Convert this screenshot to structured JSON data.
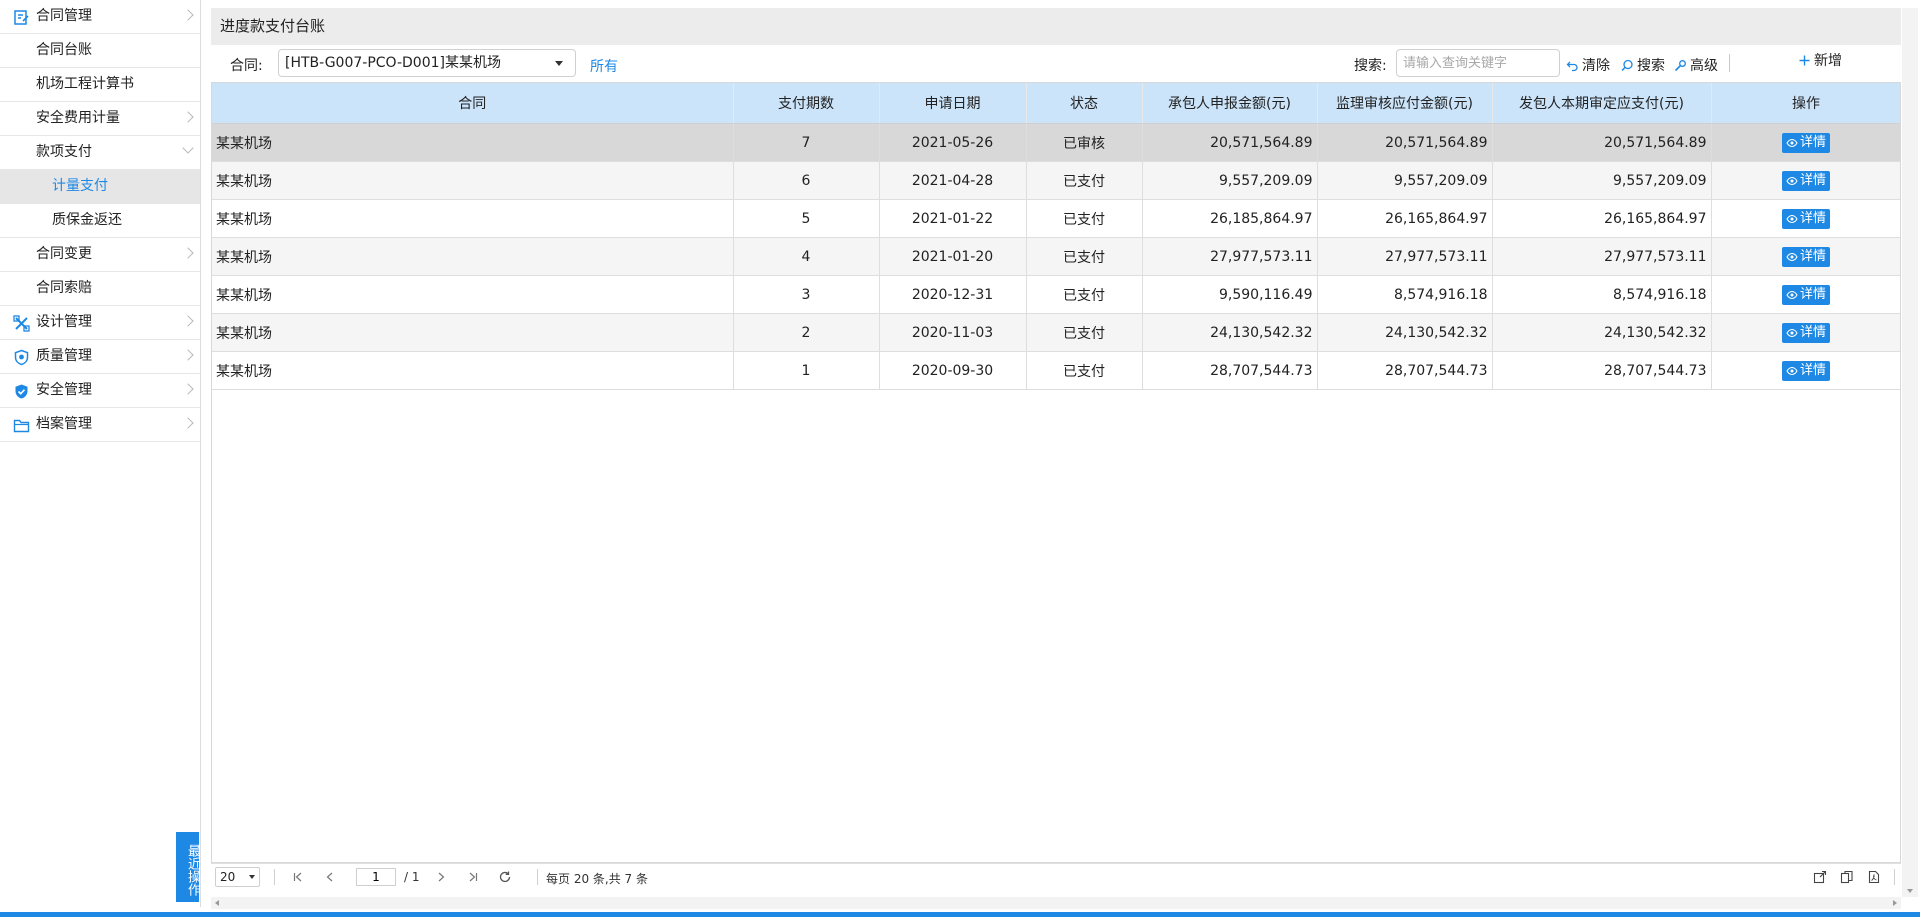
{
  "sidebar": {
    "items": [
      {
        "label": "合同管理",
        "icon": "contract-icon",
        "level": 0,
        "expanded": true
      },
      {
        "label": "合同台账",
        "level": 1
      },
      {
        "label": "机场工程计算书",
        "level": 1
      },
      {
        "label": "安全费用计量",
        "level": 1,
        "has_children": true
      },
      {
        "label": "款项支付",
        "level": 1,
        "expanded": true
      },
      {
        "label": "计量支付",
        "level": 2,
        "active": true
      },
      {
        "label": "质保金返还",
        "level": 2
      },
      {
        "label": "合同变更",
        "level": 1,
        "has_children": true
      },
      {
        "label": "合同索赔",
        "level": 1
      },
      {
        "label": "设计管理",
        "icon": "design-icon",
        "level": 0,
        "has_children": true
      },
      {
        "label": "质量管理",
        "icon": "quality-shield-icon",
        "level": 0,
        "has_children": true
      },
      {
        "label": "安全管理",
        "icon": "safety-shield-icon",
        "level": 0,
        "has_children": true
      },
      {
        "label": "档案管理",
        "icon": "folder-icon",
        "level": 0,
        "has_children": true
      }
    ],
    "recent_tab": "最近操作"
  },
  "page": {
    "title": "进度款支付台账"
  },
  "toolbar": {
    "contract_label": "合同:",
    "contract_value": "[HTB-G007-PCO-D001]某某机场",
    "all_link": "所有",
    "search_label": "搜索:",
    "search_placeholder": "请输入查询关键字",
    "clear_label": "清除",
    "search_button": "搜索",
    "advanced_label": "高级",
    "add_label": "新增"
  },
  "table": {
    "columns": [
      "合同",
      "支付期数",
      "申请日期",
      "状态",
      "承包人申报金额(元)",
      "监理审核应付金额(元)",
      "发包人本期审定应支付(元)",
      "操作"
    ],
    "rows": [
      {
        "contract": "某某机场",
        "period": "7",
        "date": "2021-05-26",
        "status": "已审核",
        "reported": "20,571,564.89",
        "supervised": "20,571,564.89",
        "approved": "20,571,564.89",
        "action": "详情"
      },
      {
        "contract": "某某机场",
        "period": "6",
        "date": "2021-04-28",
        "status": "已支付",
        "reported": "9,557,209.09",
        "supervised": "9,557,209.09",
        "approved": "9,557,209.09",
        "action": "详情"
      },
      {
        "contract": "某某机场",
        "period": "5",
        "date": "2021-01-22",
        "status": "已支付",
        "reported": "26,185,864.97",
        "supervised": "26,165,864.97",
        "approved": "26,165,864.97",
        "action": "详情"
      },
      {
        "contract": "某某机场",
        "period": "4",
        "date": "2021-01-20",
        "status": "已支付",
        "reported": "27,977,573.11",
        "supervised": "27,977,573.11",
        "approved": "27,977,573.11",
        "action": "详情"
      },
      {
        "contract": "某某机场",
        "period": "3",
        "date": "2020-12-31",
        "status": "已支付",
        "reported": "9,590,116.49",
        "supervised": "8,574,916.18",
        "approved": "8,574,916.18",
        "action": "详情"
      },
      {
        "contract": "某某机场",
        "period": "2",
        "date": "2020-11-03",
        "status": "已支付",
        "reported": "24,130,542.32",
        "supervised": "24,130,542.32",
        "approved": "24,130,542.32",
        "action": "详情"
      },
      {
        "contract": "某某机场",
        "period": "1",
        "date": "2020-09-30",
        "status": "已支付",
        "reported": "28,707,544.73",
        "supervised": "28,707,544.73",
        "approved": "28,707,544.73",
        "action": "详情"
      }
    ]
  },
  "pager": {
    "page_size": "20",
    "current_page": "1",
    "total_pages": "/ 1",
    "info": "每页 20 条,共 7 条"
  },
  "colors": {
    "accent": "#1e88e5",
    "header_bg": "#cce4fa",
    "selected_row": "#d8d8d8"
  }
}
